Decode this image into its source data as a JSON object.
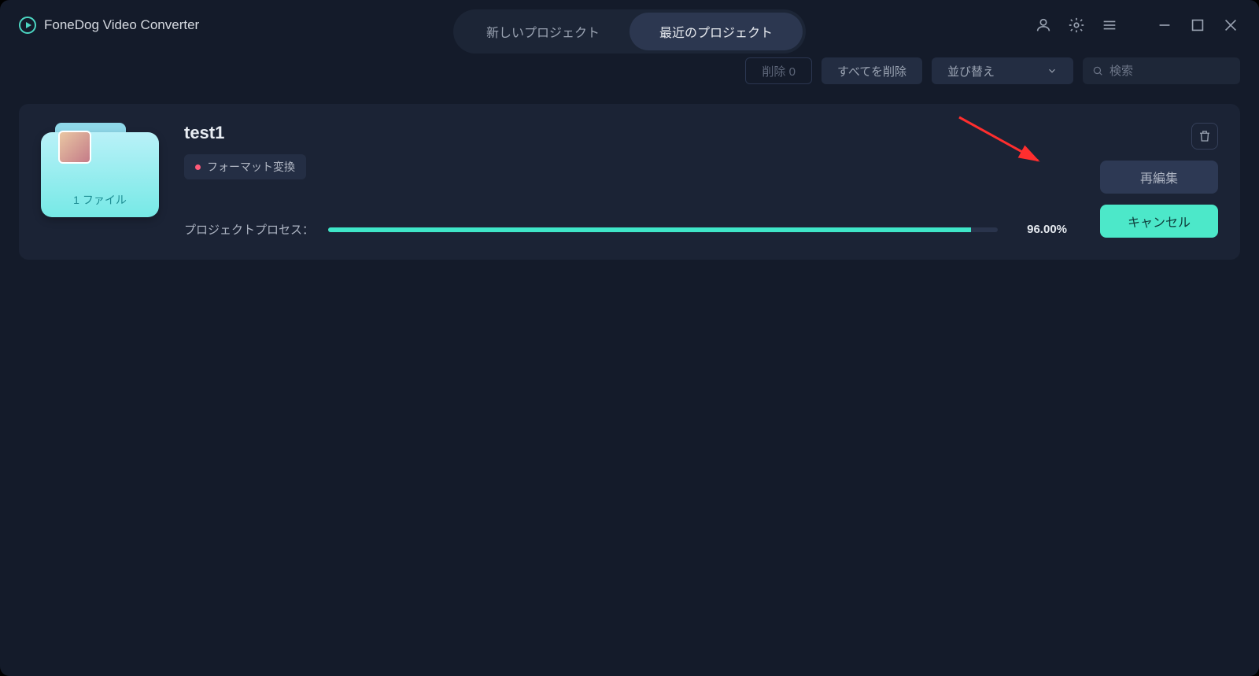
{
  "app": {
    "title": "FoneDog Video Converter"
  },
  "tabs": {
    "new_project": "新しいプロジェクト",
    "recent_projects": "最近のプロジェクト"
  },
  "toolbar": {
    "delete_label": "削除 0",
    "delete_all_label": "すべてを削除",
    "sort_label": "並び替え",
    "search_placeholder": "検索"
  },
  "project": {
    "title": "test1",
    "badge_label": "フォーマット変換",
    "file_count_label": "1 ファイル",
    "process_label": "プロジェクトプロセス：",
    "progress_pct": 96.0,
    "progress_text": "96.00%",
    "reedit_label": "再編集",
    "cancel_label": "キャンセル"
  },
  "colors": {
    "accent": "#4ce8c9",
    "bg": "#141b2a",
    "card": "#1b2335"
  }
}
